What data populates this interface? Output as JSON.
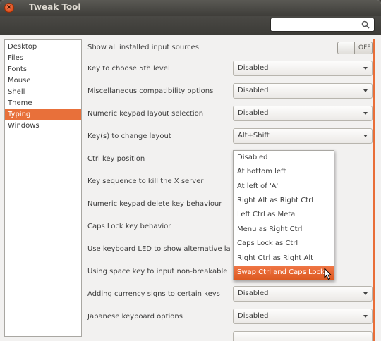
{
  "window": {
    "title": "Tweak Tool",
    "close_glyph": "×"
  },
  "search": {
    "value": "",
    "placeholder": ""
  },
  "sidebar": {
    "items": [
      {
        "label": "Desktop"
      },
      {
        "label": "Files"
      },
      {
        "label": "Fonts"
      },
      {
        "label": "Mouse"
      },
      {
        "label": "Shell"
      },
      {
        "label": "Theme"
      },
      {
        "label": "Typing",
        "selected": true
      },
      {
        "label": "Windows"
      }
    ]
  },
  "settings": [
    {
      "label": "Show all installed input sources",
      "type": "toggle",
      "value": "OFF"
    },
    {
      "label": "Key to choose 5th level",
      "type": "combo",
      "value": "Disabled"
    },
    {
      "label": "Miscellaneous compatibility options",
      "type": "combo",
      "value": "Disabled"
    },
    {
      "label": "Numeric keypad layout selection",
      "type": "combo",
      "value": "Disabled"
    },
    {
      "label": "Key(s) to change layout",
      "type": "combo",
      "value": "Alt+Shift"
    },
    {
      "label": "Ctrl key position",
      "type": "combo",
      "value": ""
    },
    {
      "label": "Key sequence to kill the X server",
      "type": "combo",
      "value": ""
    },
    {
      "label": "Numeric keypad delete key behaviour",
      "type": "combo",
      "value": ""
    },
    {
      "label": "Caps Lock key behavior",
      "type": "combo",
      "value": ""
    },
    {
      "label": "Use keyboard LED to show alternative layout",
      "type": "combo",
      "value": ""
    },
    {
      "label": "Using space key to input non-breakable spa...",
      "type": "combo",
      "value": ""
    },
    {
      "label": "Adding currency signs to certain keys",
      "type": "combo",
      "value": "Disabled"
    },
    {
      "label": "Japanese keyboard options",
      "type": "combo",
      "value": "Disabled"
    }
  ],
  "dropdown": {
    "options": [
      "Disabled",
      "At bottom left",
      "At left of 'A'",
      "Right Alt as Right Ctrl",
      "Left Ctrl as Meta",
      "Menu as Right Ctrl",
      "Caps Lock as Ctrl",
      "Right Ctrl as Right Alt",
      "Swap Ctrl and Caps Lock"
    ],
    "highlighted": "Swap Ctrl and Caps Lock"
  },
  "colors": {
    "accent": "#e8703a",
    "titlebar": "#3c3b37",
    "background": "#f2f1f0"
  }
}
